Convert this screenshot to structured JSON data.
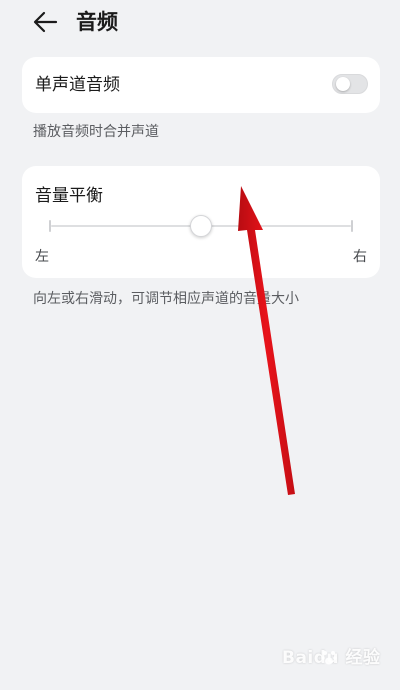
{
  "header": {
    "title": "音频",
    "back_icon": "arrow-left-icon"
  },
  "mono_audio": {
    "label": "单声道音频",
    "enabled": false,
    "hint": "播放音频时合并声道"
  },
  "balance": {
    "label": "音量平衡",
    "value": 0.5,
    "left_label": "左",
    "right_label": "右",
    "hint": "向左或右滑动，可调节相应声道的音量大小"
  },
  "annotation": {
    "arrow_color": "#e8131a"
  },
  "watermark": {
    "text": "Baidu 经验",
    "icon": "baidu-paw-icon"
  }
}
